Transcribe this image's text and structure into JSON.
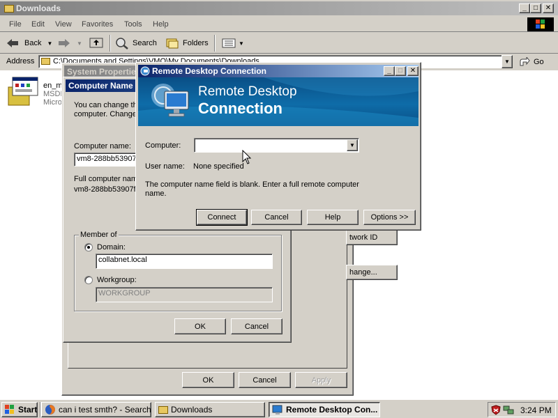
{
  "explorer": {
    "title": "Downloads",
    "menu": [
      "File",
      "Edit",
      "View",
      "Favorites",
      "Tools",
      "Help"
    ],
    "toolbar": {
      "back": "Back",
      "search": "Search",
      "folders": "Folders"
    },
    "address_label": "Address",
    "address_value": "C:\\Documents and Settings\\VMO\\My Documents\\Downloads",
    "go_label": "Go",
    "file_item": {
      "name": "en_m",
      "line2": "MSDN",
      "line3": "Micros"
    }
  },
  "system_properties": {
    "title": "System Properties",
    "computer_name_title": "Computer Name C",
    "intro_line1": "You can change th",
    "intro_line2": "computer. Change:",
    "computer_name_label": "Computer name:",
    "computer_name_value": "vm8-288bb53907f",
    "full_name_label": "Full computer name",
    "full_name_value": "vm8-288bb53907f.",
    "member_of_label": "Member of",
    "domain_label": "Domain:",
    "domain_value": "collabnet.local",
    "workgroup_label": "Workgroup:",
    "workgroup_value": "WORKGROUP",
    "inner_ok": "OK",
    "inner_cancel": "Cancel",
    "network_id_button": "twork ID",
    "change_button": "hange...",
    "ok": "OK",
    "cancel": "Cancel",
    "apply": "Apply"
  },
  "rdc": {
    "title": "Remote Desktop Connection",
    "banner_line1": "Remote Desktop",
    "banner_line2": "Connection",
    "computer_label": "Computer:",
    "computer_value": "",
    "username_label": "User name:",
    "username_value": "None specified",
    "message": "The computer name field is blank. Enter a full remote computer name.",
    "connect": "Connect",
    "cancel": "Cancel",
    "help": "Help",
    "options": "Options >>"
  },
  "taskbar": {
    "start": "Start",
    "tasks": [
      {
        "label": "can i test smth? - Search..."
      },
      {
        "label": "Downloads"
      },
      {
        "label": "Remote Desktop Con..."
      }
    ],
    "clock": "3:24 PM"
  },
  "colors": {
    "active_title": "#0a246a",
    "rdc_banner": "#0a6fa8",
    "desktop": "#d4d0c8"
  }
}
